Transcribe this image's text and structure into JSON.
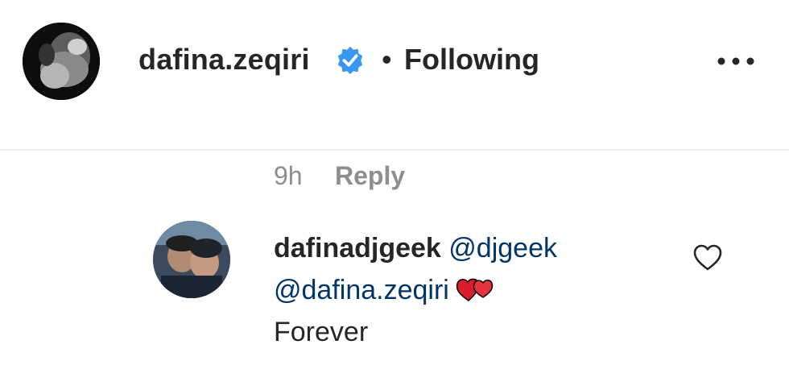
{
  "post_header": {
    "username": "dafina.zeqiri",
    "verified_icon": "verified-badge-icon",
    "separator": "•",
    "follow_status": "Following",
    "more_icon": "more-options-icon"
  },
  "comment_meta": {
    "time": "9h",
    "reply_label": "Reply"
  },
  "reply": {
    "username": "dafinadjgeek",
    "mention_1": "@djgeek",
    "mention_2": "@dafina.zeqiri",
    "emoji": "two-hearts-emoji",
    "text": "Forever",
    "like_icon": "heart-outline-icon"
  },
  "colors": {
    "text": "#262626",
    "muted": "#8e8e8e",
    "mention": "#003569",
    "verified": "#3897f0",
    "divider": "#efefef"
  }
}
